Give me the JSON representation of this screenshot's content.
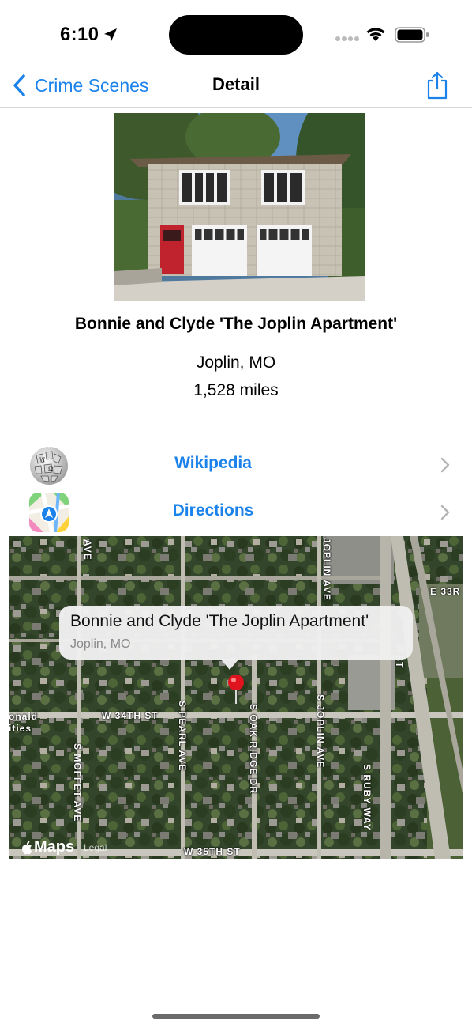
{
  "status_bar": {
    "time": "6:10"
  },
  "nav": {
    "back_label": "Crime Scenes",
    "title": "Detail"
  },
  "place": {
    "title": "Bonnie and Clyde 'The Joplin Apartment'",
    "location": "Joplin, MO",
    "distance": "1,528 miles"
  },
  "links": [
    {
      "label": "Wikipedia",
      "icon": "wikipedia-globe-icon"
    },
    {
      "label": "Directions",
      "icon": "apple-maps-icon"
    }
  ],
  "map": {
    "callout_title": "Bonnie and Clyde 'The Joplin Apartment'",
    "callout_subtitle": "Joplin, MO",
    "logo": "Maps",
    "legal": "Legal",
    "streets": {
      "w34": "W 34TH ST",
      "w35": "W 35TH ST",
      "pearl": "S PEARL AVE",
      "oak_ridge": "S OAK RIDGE DR",
      "joplin_ave_s": "S JOPLIN AVE",
      "joplin_ave_n": "JOPLIN AVE",
      "moffet": "S MOFFET AVE",
      "ruby": "S RUBY WAY",
      "st": "ST",
      "ave": "AVE",
      "e33": "E 33R",
      "onald": "onald",
      "ities": "ities"
    }
  },
  "colors": {
    "accent": "#1a82ea",
    "pin": "#e0141e"
  }
}
